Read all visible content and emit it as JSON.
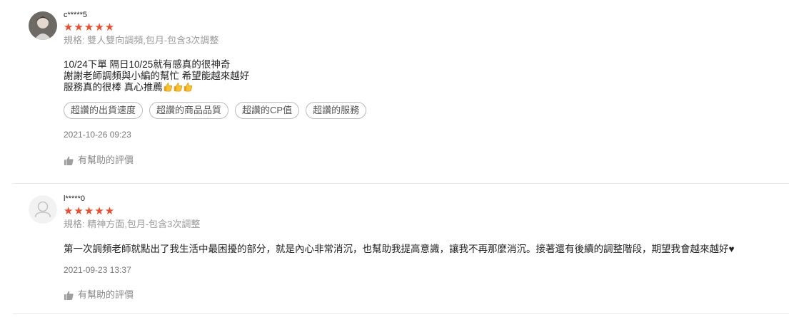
{
  "reviews": [
    {
      "username": "c*****5",
      "avatar_icon": "user-photo-avatar",
      "rating": 5,
      "stars": "★★★★★",
      "spec": "規格: 雙人雙向調頻,包月-包含3次調整",
      "content_lines": [
        "10/24下單 隔日10/25就有感真的很神奇",
        "謝謝老師調頻與小編的幫忙 希望能越來越好",
        "服務真的很棒 真心推薦"
      ],
      "emoji_icon": "thumbs-up-emoji",
      "emoji_count": 3,
      "tags": [
        "超讚的出貨速度",
        "超讚的商品品質",
        "超讚的CP值",
        "超讚的服務"
      ],
      "date": "2021-10-26 09:23",
      "helpful_label": "有幫助的評價"
    },
    {
      "username": "l*****0",
      "avatar_icon": "default-user-avatar",
      "rating": 5,
      "stars": "★★★★★",
      "spec": "規格: 精神方面,包月-包含3次調整",
      "content_lines": [
        "第一次調頻老師就點出了我生活中最困擾的部分，就是內心非常消沉，也幫助我提高意識，讓我不再那麼消沉。接著還有後續的調整階段，期望我會越來越好♥"
      ],
      "date": "2021-09-23 13:37",
      "helpful_label": "有幫助的評價"
    }
  ],
  "colors": {
    "star": "#ee4d2d",
    "muted": "#9b9b9b",
    "divider": "#e8e8e8"
  }
}
